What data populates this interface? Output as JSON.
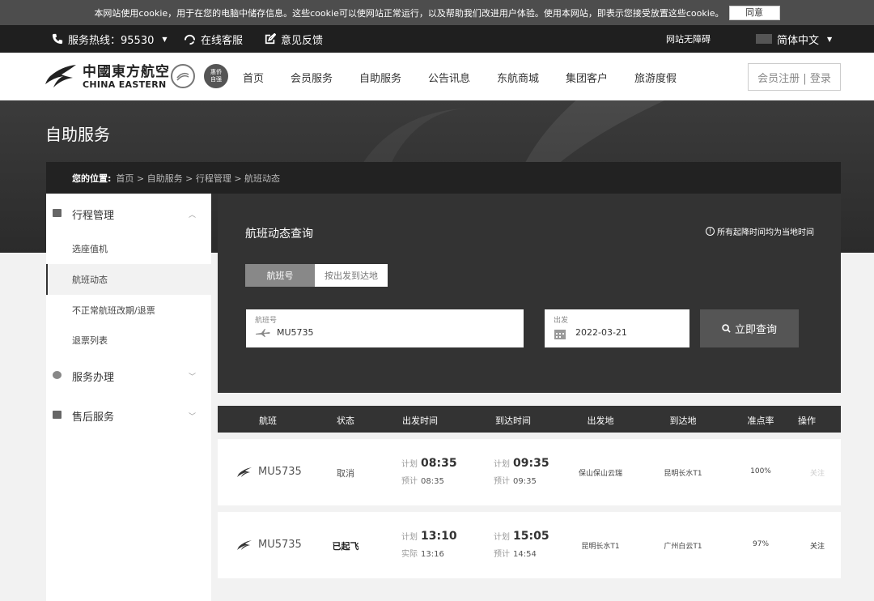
{
  "cookie": {
    "text": "本网站使用cookie，用于在您的电脑中储存信息。这些cookie可以使网站正常运行，以及帮助我们改进用户体验。使用本网站，即表示您接受放置这些cookie。",
    "agree_label": "同意"
  },
  "util": {
    "hotline_label": "服务热线：95530",
    "online_service": "在线客服",
    "feedback": "意见反馈",
    "accessibility": "网站无障碍",
    "language": "简体中文"
  },
  "brand": {
    "name_cn": "中國東方航空",
    "name_en": "CHINA EASTERN",
    "badge2_text": "惠侨 自强"
  },
  "nav": [
    "首页",
    "会员服务",
    "自助服务",
    "公告讯息",
    "东航商城",
    "集团客户",
    "旅游度假"
  ],
  "login_label": "会员注册 | 登录",
  "page": {
    "title": "自助服务",
    "breadcrumb_label": "您的位置:",
    "breadcrumb_path": "首页 > 自助服务 > 行程管理 > 航班动态"
  },
  "sidebar": {
    "groups": [
      {
        "label": "行程管理",
        "icon": "calendar-icon",
        "chev": "^"
      },
      {
        "label": "服务办理",
        "icon": "service-icon",
        "chev": "v"
      },
      {
        "label": "售后服务",
        "icon": "monitor-icon",
        "chev": "v"
      }
    ],
    "sub_items": [
      "选座值机",
      "航班动态",
      "不正常航班改期/退票",
      "退票列表"
    ],
    "active_sub": "航班动态"
  },
  "query": {
    "title": "航班动态查询",
    "note": "所有起降时间均为当地时间",
    "tab_flight_no": "航班号",
    "tab_route": "按出发到达地",
    "flight_label": "航班号",
    "flight_value": "MU5735",
    "date_label": "出发",
    "date_value": "2022-03-21",
    "search_label": "立即查询"
  },
  "table": {
    "headers": [
      "航班",
      "状态",
      "出发时间",
      "到达时间",
      "出发地",
      "到达地",
      "准点率",
      "操作"
    ],
    "rows": [
      {
        "flight": "MU5735",
        "status": "取消",
        "dep_plan_label": "计划",
        "dep_plan": "08:35",
        "dep_est_label": "预计",
        "dep_est": "08:35",
        "arr_plan_label": "计划",
        "arr_plan": "09:35",
        "arr_est_label": "预计",
        "arr_est": "09:35",
        "from": "保山保山云瑞",
        "to": "昆明长水T1",
        "ontime": "100%",
        "action": "关注"
      },
      {
        "flight": "MU5735",
        "status": "已起飞",
        "dep_plan_label": "计划",
        "dep_plan": "13:10",
        "dep_est_label": "实际",
        "dep_est": "13:16",
        "arr_plan_label": "计划",
        "arr_plan": "15:05",
        "arr_est_label": "预计",
        "arr_est": "14:54",
        "from": "昆明长水T1",
        "to": "广州白云T1",
        "ontime": "97%",
        "action": "关注"
      }
    ]
  }
}
